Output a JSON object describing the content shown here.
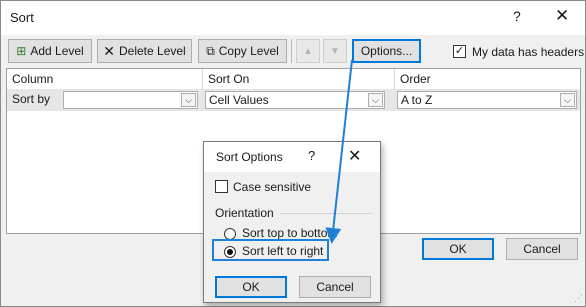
{
  "window": {
    "title": "Sort",
    "help_icon": "?",
    "close_icon": "✕"
  },
  "toolbar": {
    "add_level": "Add Level",
    "delete_level": "Delete Level",
    "copy_level": "Copy Level",
    "move_up_icon": "▲",
    "move_down_icon": "▼",
    "options": "Options...",
    "my_data_headers": "My data has headers",
    "my_data_headers_checked": true
  },
  "columns": {
    "column": "Column",
    "sort_on": "Sort On",
    "order": "Order"
  },
  "row": {
    "label": "Sort by",
    "column_value": "",
    "sort_on_value": "Cell Values",
    "order_value": "A to Z"
  },
  "main_buttons": {
    "ok": "OK",
    "cancel": "Cancel"
  },
  "sort_options": {
    "title": "Sort Options",
    "help_icon": "?",
    "close_icon": "✕",
    "case_sensitive": "Case sensitive",
    "case_sensitive_checked": false,
    "orientation_label": "Orientation",
    "top_to_bottom": "Sort top to bottom",
    "left_to_right": "Sort left to right",
    "selected": "left_to_right",
    "ok": "OK",
    "cancel": "Cancel"
  },
  "colors": {
    "accent": "#0078d7",
    "arrow": "#1f80d8"
  }
}
